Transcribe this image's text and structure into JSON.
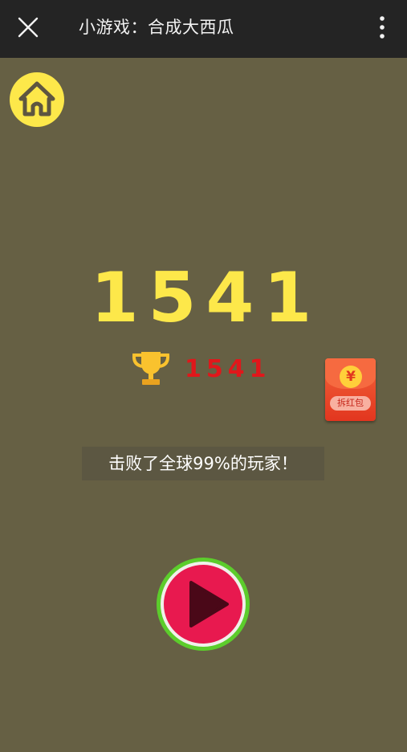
{
  "header": {
    "title": "小游戏：合成大西瓜"
  },
  "game": {
    "score": "1541",
    "best_score": "1541",
    "ranking_text": "击败了全球99%的玩家！"
  },
  "redpacket": {
    "currency_symbol": "¥",
    "label": "拆红包"
  },
  "colors": {
    "background": "#666044",
    "topbar": "#242424",
    "score_yellow": "#fde84a",
    "best_red": "#e0171b",
    "play_green": "#5ccd2c",
    "play_pink": "#e8194f"
  },
  "icons": [
    "close-icon",
    "more-vertical-icon",
    "home-icon",
    "trophy-icon",
    "play-icon",
    "coin-icon"
  ]
}
